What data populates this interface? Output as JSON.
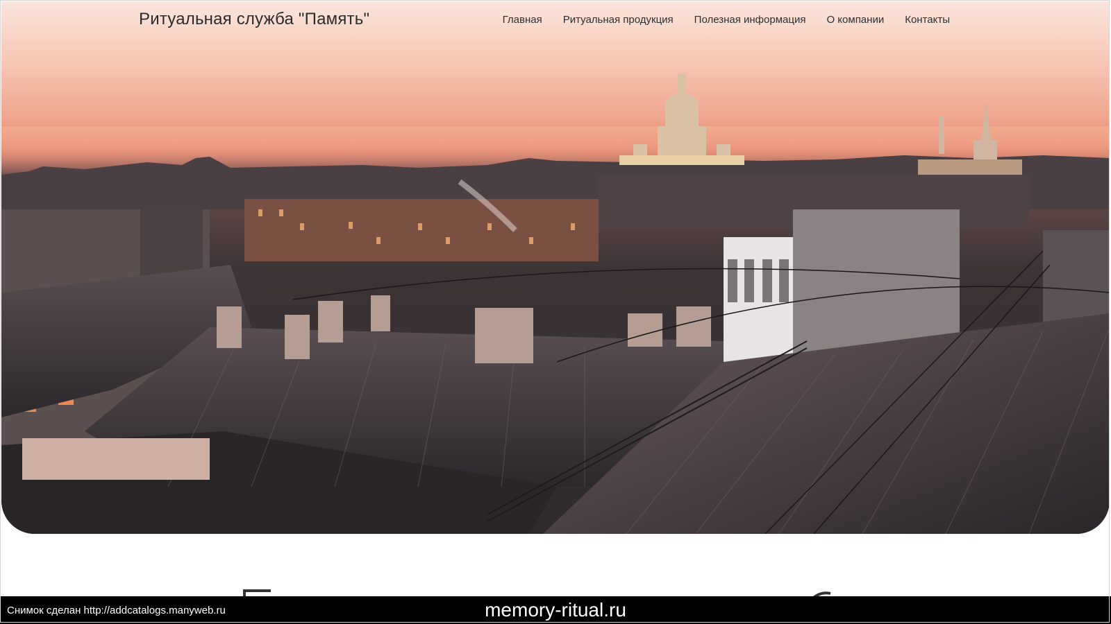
{
  "header": {
    "site_title": "Ритуальная служба \"Память\""
  },
  "nav": {
    "items": [
      {
        "label": "Главная"
      },
      {
        "label": "Ритуальная продукция"
      },
      {
        "label": "Полезная информация"
      },
      {
        "label": "О компании"
      },
      {
        "label": "Контакты"
      }
    ]
  },
  "hero": {
    "image": "city-rooftops-sunset-photo"
  },
  "caption": {
    "left_text": "Снимок сделан http://addcatalogs.manyweb.ru",
    "center_text": "memory-ritual.ru"
  },
  "colors": {
    "sky_top": "#fbe6de",
    "sky_glow": "#f0a58e",
    "roof_dark": "#2e2a2d",
    "text_dark": "#2b2b2b",
    "caption_bg": "#000000"
  }
}
